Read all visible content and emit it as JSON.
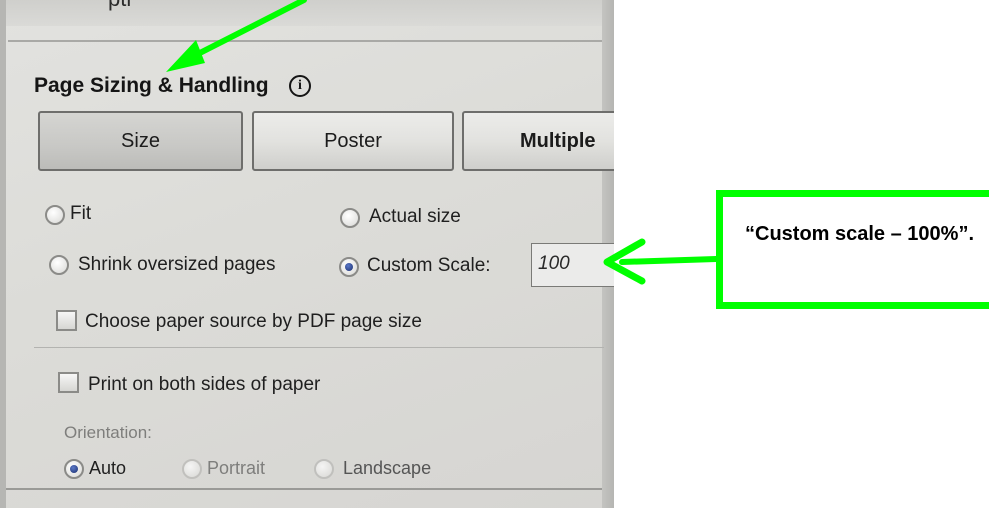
{
  "dialog": {
    "clipped_header_text": "pti",
    "section_title": "Page Sizing & Handling",
    "info_glyph": "i",
    "mode_buttons": {
      "size": "Size",
      "poster": "Poster",
      "multiple": "Multiple"
    },
    "options": {
      "fit": "Fit",
      "actual_size": "Actual size",
      "shrink_oversized": "Shrink oversized pages",
      "custom_scale": "Custom Scale:",
      "custom_scale_value": "100",
      "selected_scaling": "custom_scale",
      "paper_source": "Choose paper source by PDF page size",
      "paper_source_checked": false
    },
    "duplex": {
      "label": "Print on both sides of paper",
      "checked": false
    },
    "orientation": {
      "label": "Orientation:",
      "choices": [
        "Auto",
        "Portrait",
        "Landscape"
      ],
      "selected": "Auto"
    }
  },
  "annotation": {
    "callout_text": "“Custom scale – 100%”.",
    "highlight_color": "#00ff00"
  },
  "icons": [
    "info-icon",
    "green-arrow-pointer"
  ]
}
